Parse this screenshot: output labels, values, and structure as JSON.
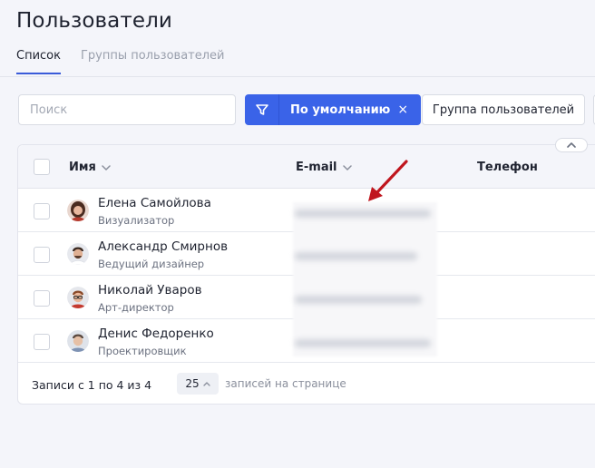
{
  "page": {
    "title": "Пользователи"
  },
  "tabs": [
    {
      "label": "Список",
      "active": true
    },
    {
      "label": "Группы пользователей",
      "active": false
    }
  ],
  "toolbar": {
    "search_placeholder": "Поиск",
    "search_value": "",
    "filter_icon": "funnel-icon",
    "active_filter": "По умолчанию",
    "active_filter_close": "×",
    "group_button": "Группа пользователей"
  },
  "table": {
    "columns": [
      "Имя",
      "E-mail",
      "Телефон"
    ],
    "rows": [
      {
        "name": "Елена Самойлова",
        "role": "Визуализатор",
        "email": "(blurred)",
        "phone": ""
      },
      {
        "name": "Александр Смирнов",
        "role": "Ведущий дизайнер",
        "email": "(blurred)",
        "phone": ""
      },
      {
        "name": "Николай Уваров",
        "role": "Арт-директор",
        "email": "(blurred)",
        "phone": ""
      },
      {
        "name": "Денис Федоренко",
        "role": "Проектировщик",
        "email": "(blurred)",
        "phone": ""
      }
    ]
  },
  "footer": {
    "records": "Записи с 1 по 4 из 4",
    "per_page_value": "25",
    "per_page_label": "записей на странице"
  },
  "colors": {
    "accent": "#3a63e8",
    "annotation": "#c0161e",
    "background": "#f4f5fa"
  }
}
